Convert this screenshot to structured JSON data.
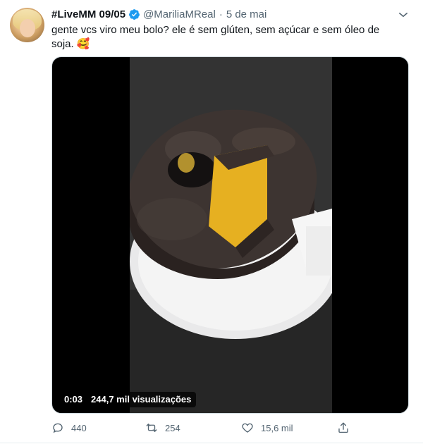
{
  "tweet": {
    "display_name": "#LiveMM 09/05",
    "handle": "@MariliaMReal",
    "separator": "·",
    "date": "5 de mai",
    "text": "gente vcs viro meu bolo? ele é sem glúten, sem açúcar e sem óleo de soja. 🥰",
    "media": {
      "time": "0:03",
      "views": "244,7 mil visualizações"
    },
    "actions": {
      "replies": "440",
      "retweets": "254",
      "likes": "15,6 mil"
    }
  },
  "icons": {
    "verified": "verified-badge-icon",
    "more": "chevron-down-icon",
    "reply": "reply-icon",
    "retweet": "retweet-icon",
    "like": "heart-icon",
    "share": "share-icon"
  },
  "colors": {
    "verified": "#1d9bf0",
    "muted": "#536471",
    "text": "#0f1419"
  }
}
